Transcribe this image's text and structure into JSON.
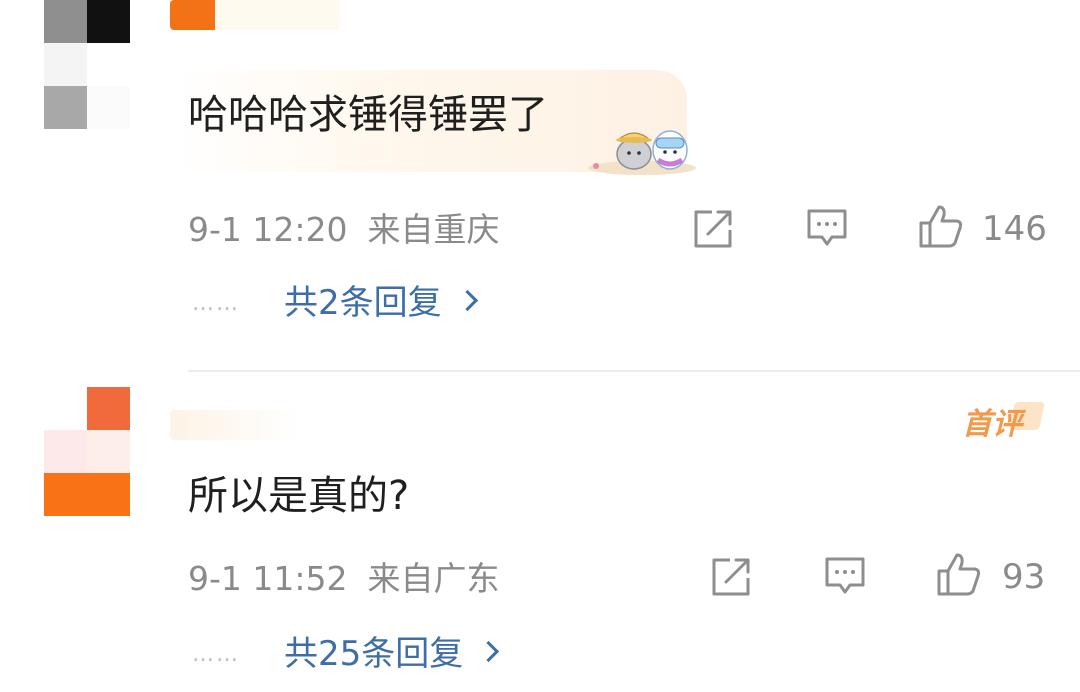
{
  "comments": [
    {
      "text": "哈哈哈求锤得锤罢了",
      "date": "9-1 12:20",
      "location": "来自重庆",
      "likes": "146",
      "replies_label": "共2条回复",
      "dots": "……",
      "has_sticker": true,
      "sticker_icon": "cartoon-sticker-icon"
    },
    {
      "text": "所以是真的?",
      "date": "9-1 11:52",
      "location": "来自广东",
      "likes": "93",
      "replies_label": "共25条回复",
      "dots": "……",
      "badge": "首评"
    }
  ],
  "colors": {
    "text": "#1f1f1f",
    "meta": "#8a8a8a",
    "link": "#3d6ea7",
    "badge": "#f29a4a",
    "avatar_orange": "#f97316"
  },
  "icons": [
    "repost-icon",
    "comment-icon",
    "like-icon",
    "chevron-right-icon"
  ]
}
